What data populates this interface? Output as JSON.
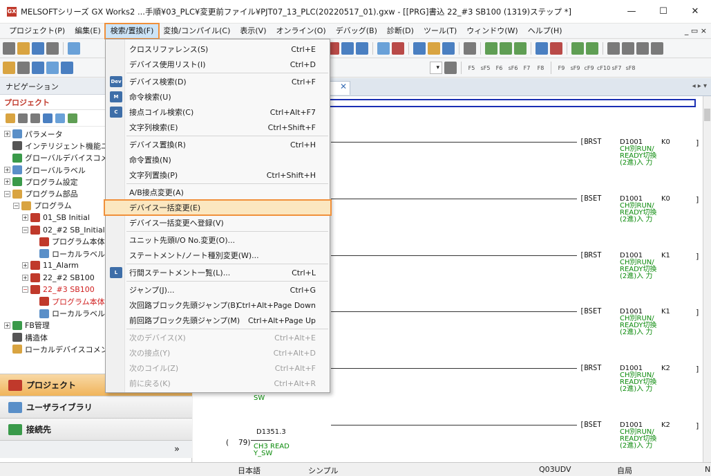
{
  "window": {
    "title": "MELSOFTシリーズ GX Works2 ...手順¥03_PLC¥変更前ファイル¥PJT07_13_PLC(20220517_01).gxw - [[PRG]書込 22_#3 SB100 (1319)ステップ *]",
    "minimize": "—",
    "maximize": "☐",
    "close": "✕"
  },
  "menubar": {
    "items": [
      "プロジェクト(P)",
      "編集(E)",
      "検索/置換(F)",
      "変換/コンパイル(C)",
      "表示(V)",
      "オンライン(O)",
      "デバッグ(B)",
      "診断(D)",
      "ツール(T)",
      "ウィンドウ(W)",
      "ヘルプ(H)"
    ],
    "right": "_ ▭ ×"
  },
  "toolbar": {
    "fkeys": [
      "F5",
      "sF5",
      "F6",
      "sF6",
      "F7",
      "F8",
      "F9",
      "sF9",
      "cF9",
      "cF10",
      "sF7",
      "sF8"
    ]
  },
  "nav": {
    "header": "ナビゲーション",
    "section": "プロジェクト",
    "tree": [
      {
        "label": "パラメータ",
        "exp": "+",
        "depth": 0,
        "color": "#5a8fc8"
      },
      {
        "label": "インテリジェント機能ユニット",
        "exp": "",
        "depth": 0,
        "color": "#555"
      },
      {
        "label": "グローバルデバイスコメント",
        "exp": "",
        "depth": 0,
        "color": "#3a9a4a"
      },
      {
        "label": "グローバルラベル",
        "exp": "+",
        "depth": 0,
        "color": "#5a8fc8"
      },
      {
        "label": "プログラム設定",
        "exp": "+",
        "depth": 0,
        "color": "#3a9a4a"
      },
      {
        "label": "プログラム部品",
        "exp": "−",
        "depth": 0,
        "color": "#d9a441"
      },
      {
        "label": "プログラム",
        "exp": "−",
        "depth": 1,
        "color": "#d9a441"
      },
      {
        "label": "01_SB Initial",
        "exp": "+",
        "depth": 2,
        "color": "#c0392b"
      },
      {
        "label": "02_#2 SB_Initial",
        "exp": "−",
        "depth": 2,
        "color": "#c0392b"
      },
      {
        "label": "プログラム本体",
        "exp": "",
        "depth": 3,
        "color": "#c0392b"
      },
      {
        "label": "ローカルラベル",
        "exp": "",
        "depth": 3,
        "color": "#5a8fc8"
      },
      {
        "label": "11_Alarm",
        "exp": "+",
        "depth": 2,
        "color": "#c0392b"
      },
      {
        "label": "22_#2 SB100",
        "exp": "+",
        "depth": 2,
        "color": "#c0392b"
      },
      {
        "label": "22_#3 SB100",
        "exp": "−",
        "depth": 2,
        "color": "#c0392b",
        "red": true
      },
      {
        "label": "プログラム本体",
        "exp": "",
        "depth": 3,
        "color": "#c0392b",
        "red": true
      },
      {
        "label": "ローカルラベル",
        "exp": "",
        "depth": 3,
        "color": "#5a8fc8"
      },
      {
        "label": "FB管理",
        "exp": "+",
        "depth": 0,
        "color": "#3a9a4a"
      },
      {
        "label": "構造体",
        "exp": "",
        "depth": 0,
        "color": "#555"
      },
      {
        "label": "ローカルデバイスコメント",
        "exp": "",
        "depth": 0,
        "color": "#d9a441"
      }
    ],
    "tabs": [
      "プロジェクト",
      "ユーザライブラリ",
      "接続先"
    ],
    "collapse": "»"
  },
  "menu": {
    "items": [
      {
        "label": "クロスリファレンス(S)",
        "shortcut": "Ctrl+E",
        "icon": "",
        "sep": false
      },
      {
        "label": "デバイス使用リスト(I)",
        "shortcut": "Ctrl+D",
        "icon": "",
        "sep": true
      },
      {
        "label": "デバイス検索(D)",
        "shortcut": "Ctrl+F",
        "icon": "Dev",
        "sep": false
      },
      {
        "label": "命令検索(U)",
        "shortcut": "",
        "icon": "M",
        "sep": false
      },
      {
        "label": "接点コイル検索(C)",
        "shortcut": "Ctrl+Alt+F7",
        "icon": "C",
        "sep": false
      },
      {
        "label": "文字列検索(E)",
        "shortcut": "Ctrl+Shift+F",
        "icon": "",
        "sep": true
      },
      {
        "label": "デバイス置換(R)",
        "shortcut": "Ctrl+H",
        "icon": "",
        "sep": false
      },
      {
        "label": "命令置換(N)",
        "shortcut": "",
        "icon": "",
        "sep": false
      },
      {
        "label": "文字列置換(P)",
        "shortcut": "Ctrl+Shift+H",
        "icon": "",
        "sep": true
      },
      {
        "label": "A/B接点変更(A)",
        "shortcut": "",
        "icon": "",
        "sep": false
      },
      {
        "label": "デバイス一括変更(E)",
        "shortcut": "",
        "icon": "",
        "sep": false,
        "highlight": true
      },
      {
        "label": "デバイス一括変更へ登録(V)",
        "shortcut": "",
        "icon": "",
        "sep": true
      },
      {
        "label": "ユニット先頭I/O No.変更(O)...",
        "shortcut": "",
        "icon": "",
        "sep": false
      },
      {
        "label": "ステートメント/ノート種別変更(W)...",
        "shortcut": "",
        "icon": "",
        "sep": true
      },
      {
        "label": "行間ステートメント一覧(L)...",
        "shortcut": "Ctrl+L",
        "icon": "L",
        "sep": true
      },
      {
        "label": "ジャンプ(J)...",
        "shortcut": "Ctrl+G",
        "icon": "",
        "sep": false
      },
      {
        "label": "次回路ブロック先頭ジャンプ(B)",
        "shortcut": "Ctrl+Alt+Page Down",
        "icon": "",
        "sep": false
      },
      {
        "label": "前回路ブロック先頭ジャンプ(M)",
        "shortcut": "Ctrl+Alt+Page Up",
        "icon": "",
        "sep": true
      },
      {
        "label": "次のデバイス(X)",
        "shortcut": "Ctrl+Alt+E",
        "icon": "",
        "sep": false,
        "disabled": true
      },
      {
        "label": "次の接点(Y)",
        "shortcut": "Ctrl+Alt+D",
        "icon": "",
        "sep": false,
        "disabled": true
      },
      {
        "label": "次のコイル(Z)",
        "shortcut": "Ctrl+Alt+F",
        "icon": "",
        "sep": false,
        "disabled": true
      },
      {
        "label": "前に戻る(K)",
        "shortcut": "Ctrl+Alt+R",
        "icon": "",
        "sep": false,
        "disabled": true
      }
    ]
  },
  "ladder": {
    "rungs": [
      {
        "instr": "[BRST",
        "device": "D1001",
        "k": "K0"
      },
      {
        "instr": "[BSET",
        "device": "D1001",
        "k": "K0"
      },
      {
        "instr": "[BRST",
        "device": "D1001",
        "k": "K1"
      },
      {
        "instr": "[BSET",
        "device": "D1001",
        "k": "K1"
      },
      {
        "instr": "[BRST",
        "device": "D1001",
        "k": "K2"
      },
      {
        "instr": "[BSET",
        "device": "D1001",
        "k": "K2"
      }
    ],
    "comment": "CH別RUN/ READY切換 (2進)入 力",
    "step": "79)",
    "step_prefix": "(",
    "contact": "D1351.3",
    "contact_comment": "CH3 READ Y_SW",
    "sw_fragment": "SW",
    "bracket": "]"
  },
  "status": {
    "lang": "日本語",
    "mode": "シンプル",
    "cpu": "Q03UDV",
    "station": "自局",
    "extra": "N"
  }
}
